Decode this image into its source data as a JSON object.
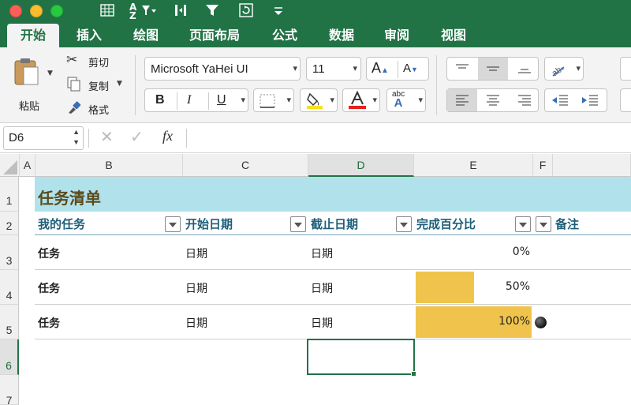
{
  "ribbon_tabs": [
    "开始",
    "插入",
    "绘图",
    "页面布局",
    "公式",
    "数据",
    "审阅",
    "视图"
  ],
  "clipboard": {
    "paste": "粘贴",
    "cut": "剪切",
    "copy": "复制",
    "format_painter": "格式"
  },
  "font": {
    "name": "Microsoft YaHei UI",
    "size": "11"
  },
  "format_buttons": {
    "bold": "B",
    "italic": "I",
    "underline": "U",
    "spell": "abc"
  },
  "formula_bar": {
    "name_box": "D6",
    "fx": "fx",
    "value": ""
  },
  "columns": [
    "A",
    "B",
    "C",
    "D",
    "E",
    "F"
  ],
  "rows": [
    "1",
    "2",
    "3",
    "4",
    "5",
    "6",
    "7"
  ],
  "sheet": {
    "title": "任务清单",
    "headers": {
      "task": "我的任务",
      "start": "开始日期",
      "end": "截止日期",
      "percent": "完成百分比",
      "notes": "备注"
    },
    "tasks": [
      {
        "task": "任务",
        "start": "日期",
        "end": "日期",
        "percent_text": "0%",
        "percent": 0
      },
      {
        "task": "任务",
        "start": "日期",
        "end": "日期",
        "percent_text": "50%",
        "percent": 0.5
      },
      {
        "task": "任务",
        "start": "日期",
        "end": "日期",
        "percent_text": "100%",
        "percent": 1.0
      }
    ]
  },
  "colors": {
    "accent": "#217346",
    "title_band": "#b1e2ec",
    "title_text": "#5b4a1b",
    "header_text": "#1d5e78",
    "data_bar": "#f0c44c"
  }
}
